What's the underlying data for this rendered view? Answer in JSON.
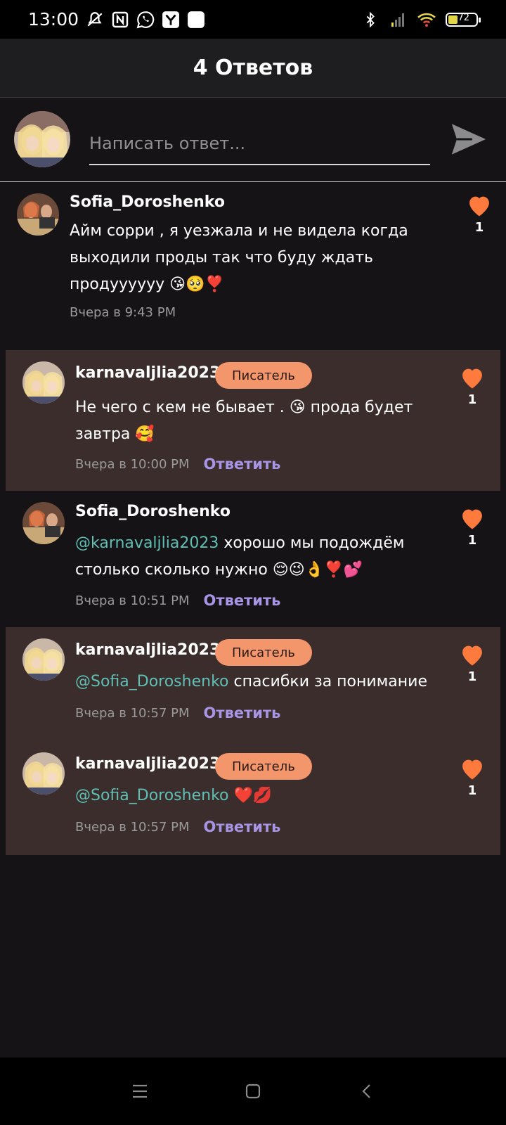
{
  "status_bar": {
    "time": "13:00",
    "left_icons": [
      "mute-icon",
      "nfc-icon",
      "whatsapp-icon",
      "app-y-icon",
      "app-square-icon"
    ],
    "right_icons": [
      "bluetooth-icon",
      "signal-icon",
      "wifi-icon",
      "battery-icon"
    ],
    "battery_level": "72"
  },
  "header": {
    "title": "4 Ответов"
  },
  "composer": {
    "placeholder": "Написать ответ...",
    "send_icon": "send-icon"
  },
  "comments": [
    {
      "username": "Sofia_Doroshenko",
      "badge": "",
      "mention": "",
      "text": "Айм сорри , я уезжала и не видела когда выходили проды так что буду ждать продуууууу 😘🥺❣️",
      "timestamp": "Вчера в 9:43 PM",
      "reply_label": "",
      "likes": "1"
    },
    {
      "username": "karnavaljlia2023",
      "badge": "Писатель",
      "mention": "",
      "text": "Не чего с кем не бывает . 😘 прода будет завтра 🥰",
      "timestamp": "Вчера в 10:00 PM",
      "reply_label": "Ответить",
      "likes": "1"
    },
    {
      "username": "Sofia_Doroshenko",
      "badge": "",
      "mention": "@karnavaljlia2023",
      "text": " хорошо мы подождём столько сколько нужно 😌😉👌❣️💕",
      "timestamp": "Вчера в 10:51 PM",
      "reply_label": "Ответить",
      "likes": "1"
    },
    {
      "username": "karnavaljlia2023",
      "badge": "Писатель",
      "mention": "@Sofia_Doroshenko",
      "text": " спасибки за понимание",
      "timestamp": "Вчера в 10:57 PM",
      "reply_label": "Ответить",
      "likes": "1"
    },
    {
      "username": "karnavaljlia2023",
      "badge": "Писатель",
      "mention": "@Sofia_Doroshenko",
      "text": " ❤️💋",
      "timestamp": "Вчера в 10:57 PM",
      "reply_label": "Ответить",
      "likes": "1"
    }
  ],
  "nav_bar": {
    "menu_icon": "menu-icon",
    "home_icon": "home-icon",
    "back_icon": "back-icon"
  },
  "colors": {
    "background": "#151316",
    "header": "#1e1d1f",
    "highlight": "#3b2d2c",
    "badge": "#f4966c",
    "heart": "#ff7a3d",
    "mention": "#5fbfb5",
    "reply": "#a995e6"
  }
}
